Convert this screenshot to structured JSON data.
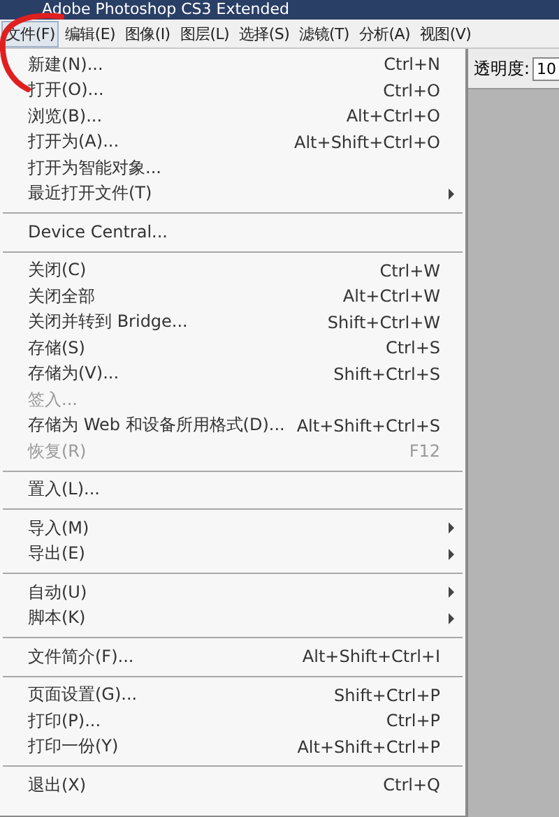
{
  "window": {
    "title": "Adobe Photoshop CS3 Extended"
  },
  "menubar": [
    {
      "label": "文件(F)",
      "selected": true
    },
    {
      "label": "编辑(E)",
      "selected": false
    },
    {
      "label": "图像(I)",
      "selected": false
    },
    {
      "label": "图层(L)",
      "selected": false
    },
    {
      "label": "选择(S)",
      "selected": false
    },
    {
      "label": "滤镜(T)",
      "selected": false
    },
    {
      "label": "分析(A)",
      "selected": false
    },
    {
      "label": "视图(V)",
      "selected": false
    }
  ],
  "options_bar": {
    "opacity_label": "透明度:",
    "opacity_value": "10"
  },
  "file_menu": [
    [
      {
        "label": "新建(N)...",
        "shortcut": "Ctrl+N",
        "submenu": false,
        "disabled": false
      },
      {
        "label": "打开(O)...",
        "shortcut": "Ctrl+O",
        "submenu": false,
        "disabled": false
      },
      {
        "label": "浏览(B)...",
        "shortcut": "Alt+Ctrl+O",
        "submenu": false,
        "disabled": false
      },
      {
        "label": "打开为(A)...",
        "shortcut": "Alt+Shift+Ctrl+O",
        "submenu": false,
        "disabled": false
      },
      {
        "label": "打开为智能对象...",
        "submenu": false,
        "disabled": false
      },
      {
        "label": "最近打开文件(T)",
        "submenu": true,
        "disabled": false
      }
    ],
    [
      {
        "label": "Device Central...",
        "submenu": false,
        "disabled": false
      }
    ],
    [
      {
        "label": "关闭(C)",
        "shortcut": "Ctrl+W",
        "submenu": false,
        "disabled": false
      },
      {
        "label": "关闭全部",
        "shortcut": "Alt+Ctrl+W",
        "submenu": false,
        "disabled": false
      },
      {
        "label": "关闭并转到 Bridge...",
        "shortcut": "Shift+Ctrl+W",
        "submenu": false,
        "disabled": false
      },
      {
        "label": "存储(S)",
        "shortcut": "Ctrl+S",
        "submenu": false,
        "disabled": false
      },
      {
        "label": "存储为(V)...",
        "shortcut": "Shift+Ctrl+S",
        "submenu": false,
        "disabled": false
      },
      {
        "label": "签入...",
        "submenu": false,
        "disabled": true
      },
      {
        "label": "存储为 Web 和设备所用格式(D)...",
        "shortcut": "Alt+Shift+Ctrl+S",
        "submenu": false,
        "disabled": false
      },
      {
        "label": "恢复(R)",
        "shortcut": "F12",
        "submenu": false,
        "disabled": true
      }
    ],
    [
      {
        "label": "置入(L)...",
        "submenu": false,
        "disabled": false
      }
    ],
    [
      {
        "label": "导入(M)",
        "submenu": true,
        "disabled": false
      },
      {
        "label": "导出(E)",
        "submenu": true,
        "disabled": false
      }
    ],
    [
      {
        "label": "自动(U)",
        "submenu": true,
        "disabled": false
      },
      {
        "label": "脚本(K)",
        "submenu": true,
        "disabled": false
      }
    ],
    [
      {
        "label": "文件简介(F)...",
        "shortcut": "Alt+Shift+Ctrl+I",
        "submenu": false,
        "disabled": false
      }
    ],
    [
      {
        "label": "页面设置(G)...",
        "shortcut": "Shift+Ctrl+P",
        "submenu": false,
        "disabled": false
      },
      {
        "label": "打印(P)...",
        "shortcut": "Ctrl+P",
        "submenu": false,
        "disabled": false
      },
      {
        "label": "打印一份(Y)",
        "shortcut": "Alt+Shift+Ctrl+P",
        "submenu": false,
        "disabled": false
      }
    ],
    [
      {
        "label": "退出(X)",
        "shortcut": "Ctrl+Q",
        "submenu": false,
        "disabled": false
      }
    ]
  ]
}
